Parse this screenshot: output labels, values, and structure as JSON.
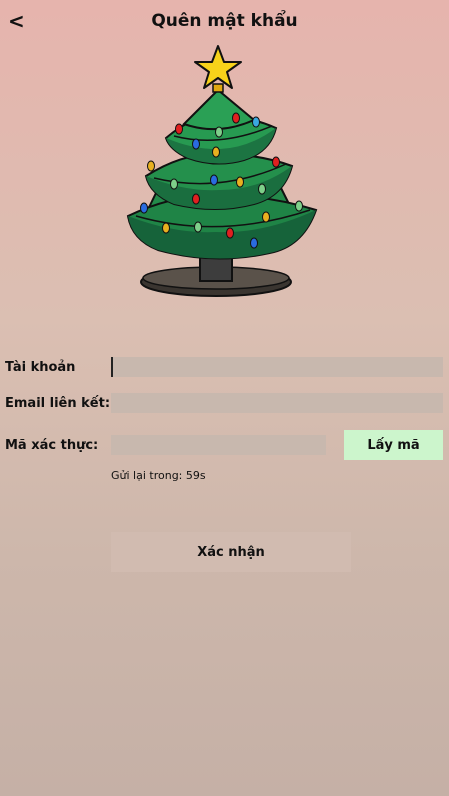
{
  "header": {
    "back_label": "<",
    "title": "Quên mật khẩu"
  },
  "illustration": {
    "icon": "christmas-tree-icon"
  },
  "form": {
    "account_label": "Tài khoản",
    "account_value": "",
    "email_label": "Email liên kết:",
    "email_value": "",
    "code_label": "Mã xác thực:",
    "code_value": "",
    "get_code_label": "Lấy mã",
    "resend_text": "Gửi lại trong: 59s",
    "confirm_label": "Xác nhận"
  },
  "colors": {
    "background_top": "#e6b4ad",
    "background_bottom": "#c5b0a6",
    "field": "#c8b8ae",
    "get_code_button": "#ccf5cc"
  }
}
